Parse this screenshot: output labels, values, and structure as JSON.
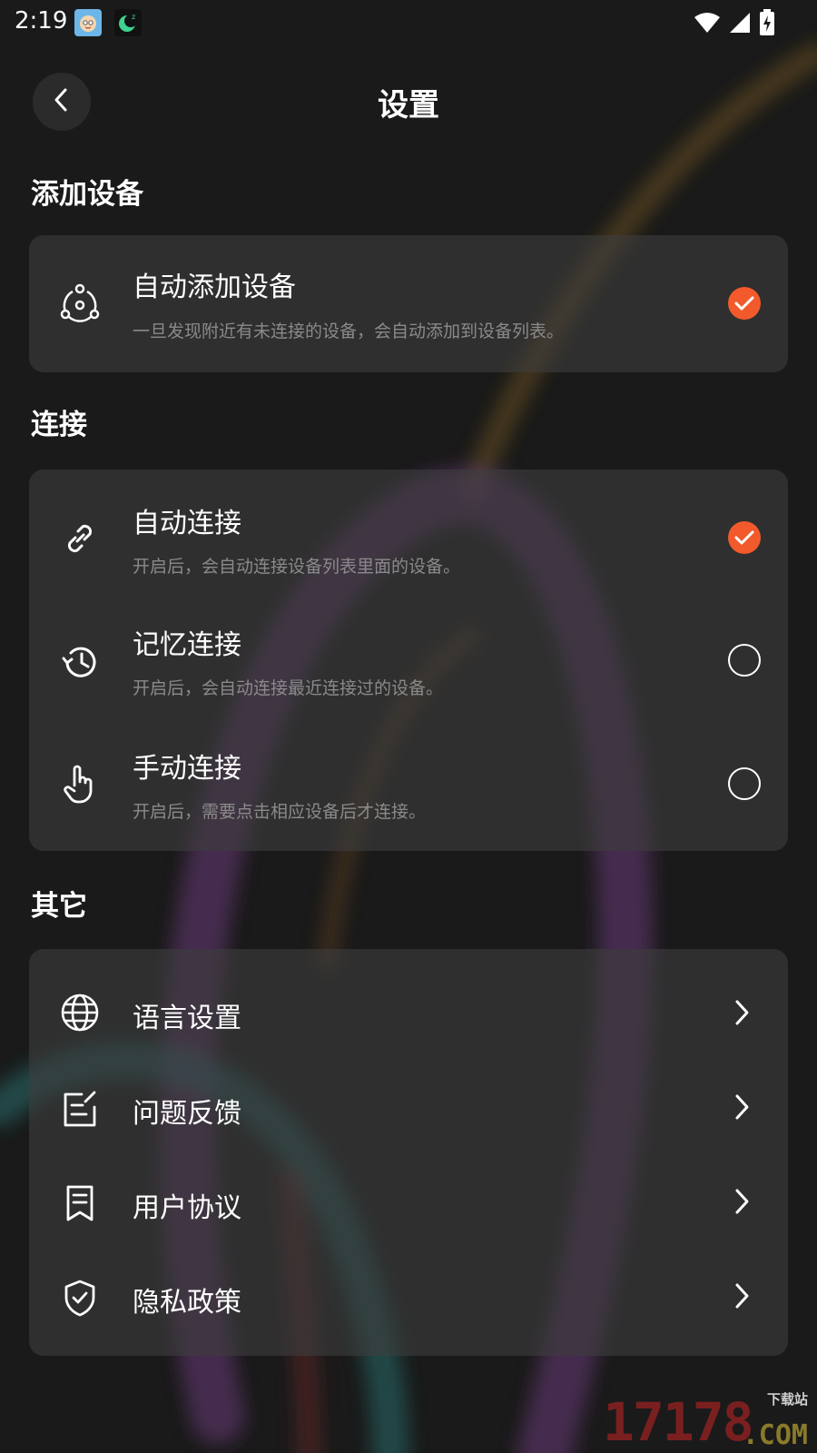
{
  "status_bar": {
    "time": "2:19",
    "app_icons": [
      "baby-face-icon",
      "moon-icon"
    ],
    "right_icons": [
      "wifi-icon",
      "signal-icon",
      "battery-charging-icon"
    ]
  },
  "header": {
    "title": "设置",
    "back_icon": "chevron-left-icon"
  },
  "sections": {
    "add_device": {
      "title": "添加设备",
      "items": [
        {
          "icon": "device-network-icon",
          "title": "自动添加设备",
          "desc": "一旦发现附近有未连接的设备，会自动添加到设备列表。",
          "checked": true
        }
      ]
    },
    "connection": {
      "title": "连接",
      "items": [
        {
          "icon": "link-icon",
          "title": "自动连接",
          "desc": "开启后，会自动连接设备列表里面的设备。",
          "checked": true
        },
        {
          "icon": "history-icon",
          "title": "记忆连接",
          "desc": "开启后，会自动连接最近连接过的设备。",
          "checked": false
        },
        {
          "icon": "hand-pointer-icon",
          "title": "手动连接",
          "desc": "开启后，需要点击相应设备后才连接。",
          "checked": false
        }
      ]
    },
    "other": {
      "title": "其它",
      "items": [
        {
          "icon": "globe-icon",
          "title": "语言设置"
        },
        {
          "icon": "edit-note-icon",
          "title": "问题反馈"
        },
        {
          "icon": "document-icon",
          "title": "用户协议"
        },
        {
          "icon": "shield-check-icon",
          "title": "隐私政策"
        }
      ]
    }
  },
  "colors": {
    "accent": "#f25a2b",
    "background": "#1a1a1a",
    "card": "#3e3e3e",
    "desc_text": "#8a8a8a"
  },
  "watermark": {
    "number": "17178",
    "top_text": "下载站",
    "domain": ".COM"
  }
}
